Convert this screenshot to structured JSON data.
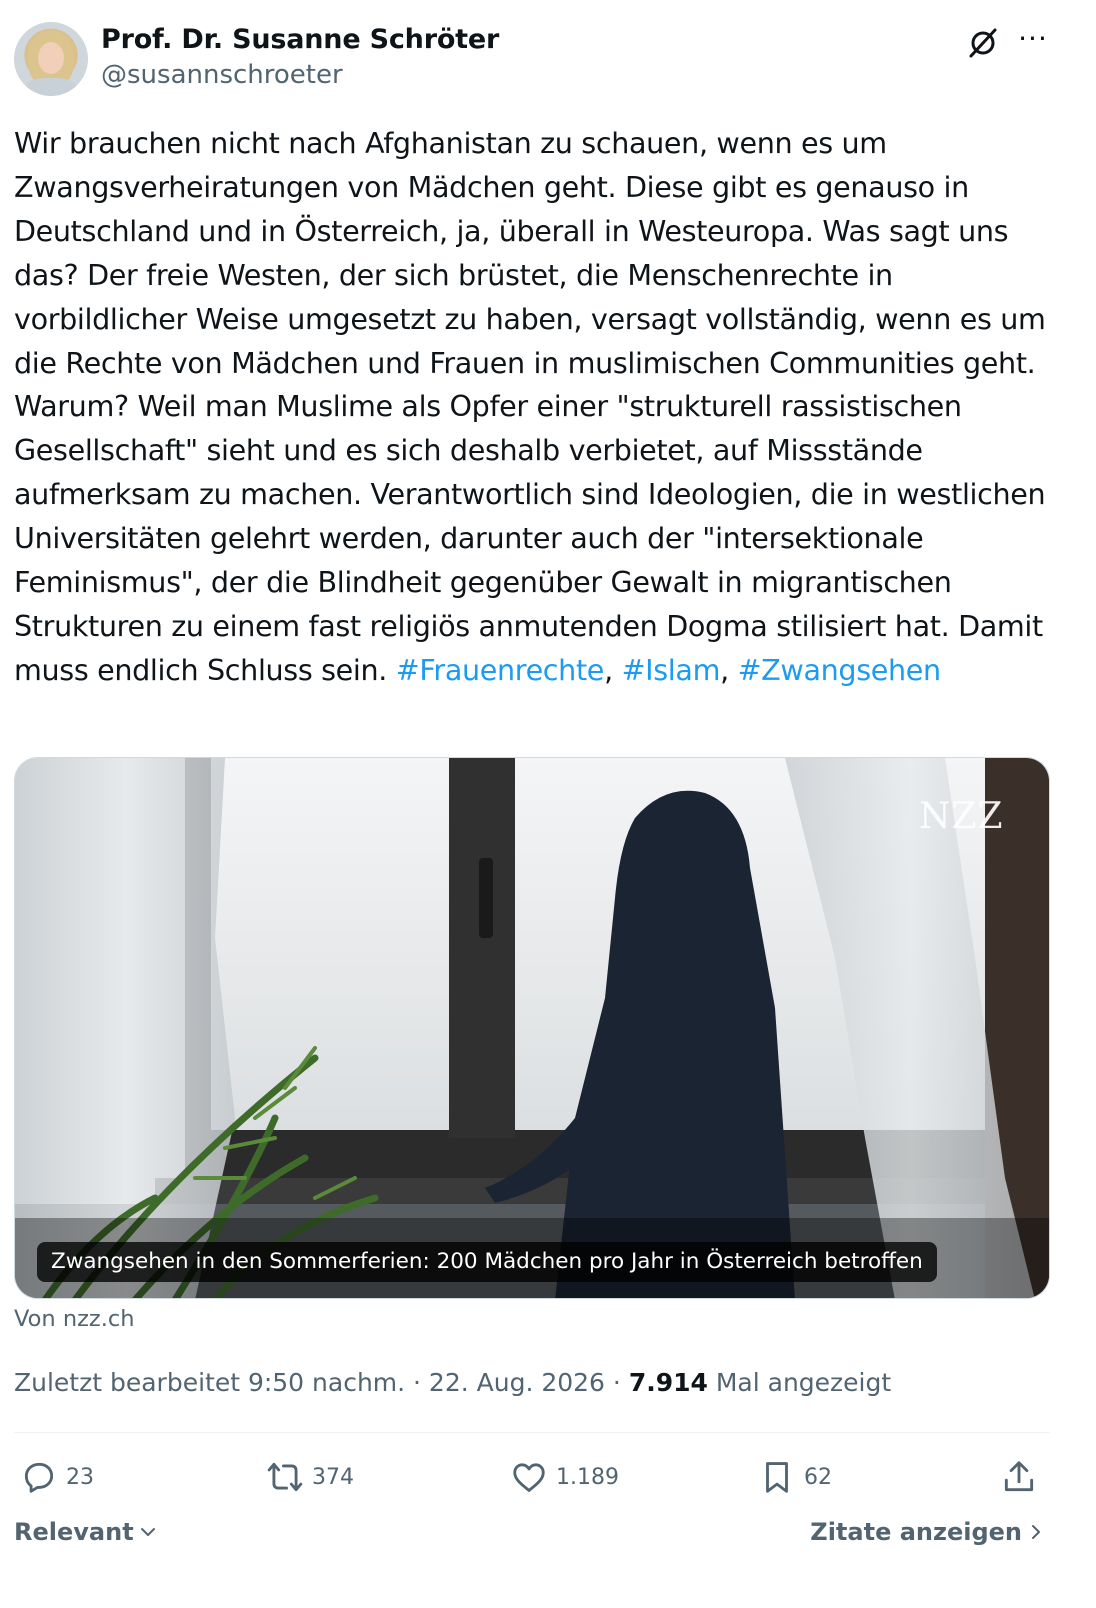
{
  "author": {
    "name": "Prof. Dr. Susanne Schröter",
    "handle": "@susannschroeter"
  },
  "tweet": {
    "text": "Wir brauchen nicht nach Afghanistan zu schauen, wenn es um Zwangsverheiratungen von Mädchen geht. Diese gibt es genauso in Deutschland und in Österreich, ja, überall in Westeuropa. Was sagt uns das? Der freie Westen, der sich brüstet, die Menschenrechte in vorbildlicher Weise umgesetzt zu haben, versagt vollständig, wenn es um die Rechte von Mädchen und Frauen in muslimischen Communities geht. Warum? Weil man Muslime als Opfer einer \"strukturell rassistischen Gesellschaft\" sieht und es sich deshalb verbietet, auf Missstände aufmerksam zu machen. Verantwortlich sind Ideologien, die in westlichen Universitäten gelehrt werden, darunter auch der \"intersektionale Feminismus\", der die Blindheit gegenüber Gewalt in migrantischen Strukturen zu einem fast religiös anmutenden Dogma stilisiert hat. Damit muss endlich Schluss sein.",
    "hashtags": [
      "#Frauenrechte",
      "#Islam",
      "#Zwangsehen"
    ],
    "separator": ","
  },
  "card": {
    "logo": "NZZ",
    "caption": "Zwangsehen in den Sommerferien: 200 Mädchen pro Jahr in Österreich betroffen",
    "source": "Von nzz.ch"
  },
  "meta": {
    "edited": "Zuletzt bearbeitet 9:50 nachm. · 22. Aug. 2026 ·",
    "views_count": "7.914",
    "views_label": "Mal angezeigt"
  },
  "actions": {
    "replies": "23",
    "retweets": "374",
    "likes": "1.189",
    "bookmarks": "62"
  },
  "footer": {
    "sort_label": "Relevant",
    "quotes_label": "Zitate anzeigen"
  },
  "colors": {
    "accent": "#1d9bf0",
    "secondary_text": "#536471",
    "primary_text": "#0f1419"
  },
  "icons": [
    "grok-icon",
    "more-icon",
    "reply-icon",
    "retweet-icon",
    "like-icon",
    "bookmark-icon",
    "share-icon",
    "chevron-down-icon",
    "chevron-right-icon"
  ]
}
